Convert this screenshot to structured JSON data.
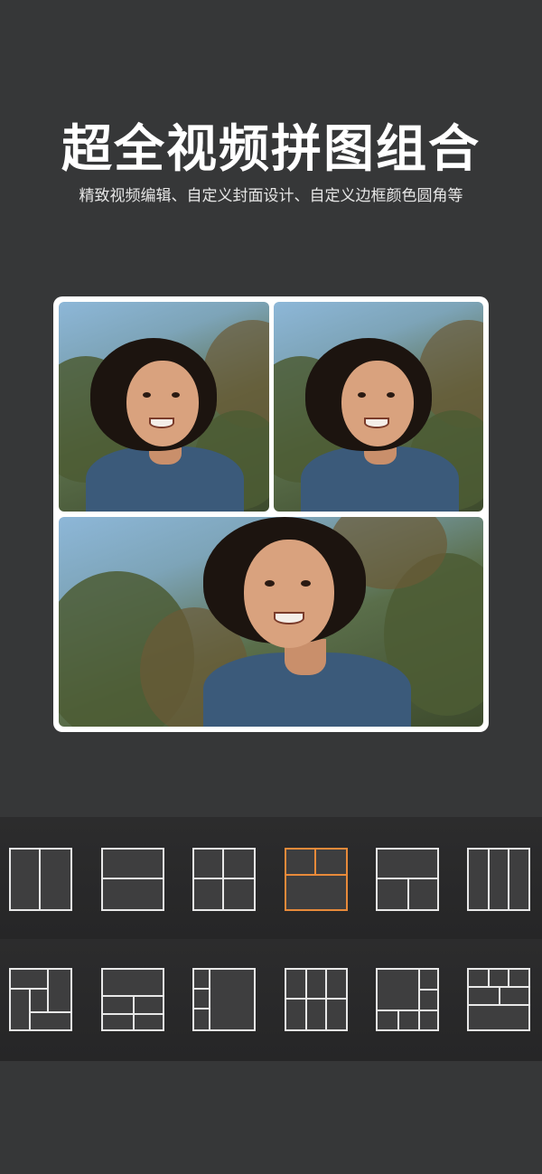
{
  "header": {
    "title": "超全视频拼图组合",
    "subtitle": "精致视频编辑、自定义封面设计、自定义边框颜色圆角等"
  },
  "collage": {
    "photos": [
      {
        "name": "photo-top-left"
      },
      {
        "name": "photo-top-right"
      },
      {
        "name": "photo-bottom"
      }
    ]
  },
  "templates": {
    "selected_index": 3,
    "accent_color": "#e88a3a",
    "items": [
      "layout-2-columns",
      "layout-2-rows",
      "layout-2x2-grid",
      "layout-2-top-1-bottom",
      "layout-1-top-2-bottom",
      "layout-3-columns",
      "layout-spiral",
      "layout-1-top-3-bottom",
      "layout-narrow-left-wide-right",
      "layout-3-columns-split",
      "layout-big-left-stack-right",
      "layout-3-top-2-mid-1-bottom"
    ]
  }
}
